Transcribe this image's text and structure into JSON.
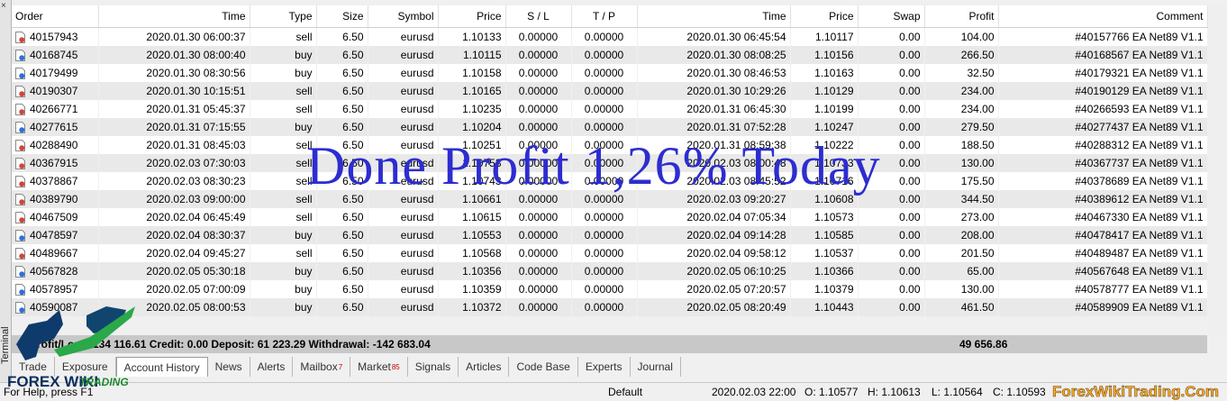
{
  "window": {
    "side_panel_label": "Terminal",
    "close_glyph": "×"
  },
  "columns": [
    "Order",
    "Time",
    "Type",
    "Size",
    "Symbol",
    "Price",
    "S / L",
    "T / P",
    "Time",
    "Price",
    "Swap",
    "Profit",
    "Comment"
  ],
  "rows": [
    {
      "order": "40157943",
      "open_time": "2020.01.30 06:00:37",
      "type": "sell",
      "size": "6.50",
      "symbol": "eurusd",
      "open_price": "1.10133",
      "sl": "0.00000",
      "tp": "0.00000",
      "close_time": "2020.01.30 06:45:54",
      "close_price": "1.10117",
      "swap": "0.00",
      "profit": "104.00",
      "comment": "#40157766 EA Net89 V1.1"
    },
    {
      "order": "40168745",
      "open_time": "2020.01.30 08:00:40",
      "type": "buy",
      "size": "6.50",
      "symbol": "eurusd",
      "open_price": "1.10115",
      "sl": "0.00000",
      "tp": "0.00000",
      "close_time": "2020.01.30 08:08:25",
      "close_price": "1.10156",
      "swap": "0.00",
      "profit": "266.50",
      "comment": "#40168567 EA Net89 V1.1"
    },
    {
      "order": "40179499",
      "open_time": "2020.01.30 08:30:56",
      "type": "buy",
      "size": "6.50",
      "symbol": "eurusd",
      "open_price": "1.10158",
      "sl": "0.00000",
      "tp": "0.00000",
      "close_time": "2020.01.30 08:46:53",
      "close_price": "1.10163",
      "swap": "0.00",
      "profit": "32.50",
      "comment": "#40179321 EA Net89 V1.1"
    },
    {
      "order": "40190307",
      "open_time": "2020.01.30 10:15:51",
      "type": "sell",
      "size": "6.50",
      "symbol": "eurusd",
      "open_price": "1.10165",
      "sl": "0.00000",
      "tp": "0.00000",
      "close_time": "2020.01.30 10:29:26",
      "close_price": "1.10129",
      "swap": "0.00",
      "profit": "234.00",
      "comment": "#40190129 EA Net89 V1.1"
    },
    {
      "order": "40266771",
      "open_time": "2020.01.31 05:45:37",
      "type": "sell",
      "size": "6.50",
      "symbol": "eurusd",
      "open_price": "1.10235",
      "sl": "0.00000",
      "tp": "0.00000",
      "close_time": "2020.01.31 06:45:30",
      "close_price": "1.10199",
      "swap": "0.00",
      "profit": "234.00",
      "comment": "#40266593 EA Net89 V1.1"
    },
    {
      "order": "40277615",
      "open_time": "2020.01.31 07:15:55",
      "type": "buy",
      "size": "6.50",
      "symbol": "eurusd",
      "open_price": "1.10204",
      "sl": "0.00000",
      "tp": "0.00000",
      "close_time": "2020.01.31 07:52:28",
      "close_price": "1.10247",
      "swap": "0.00",
      "profit": "279.50",
      "comment": "#40277437 EA Net89 V1.1"
    },
    {
      "order": "40288490",
      "open_time": "2020.01.31 08:45:03",
      "type": "sell",
      "size": "6.50",
      "symbol": "eurusd",
      "open_price": "1.10251",
      "sl": "0.00000",
      "tp": "0.00000",
      "close_time": "2020.01.31 08:59:38",
      "close_price": "1.10222",
      "swap": "0.00",
      "profit": "188.50",
      "comment": "#40288312 EA Net89 V1.1"
    },
    {
      "order": "40367915",
      "open_time": "2020.02.03 07:30:03",
      "type": "sell",
      "size": "6.50",
      "symbol": "eurusd",
      "open_price": "1.10753",
      "sl": "0.00000",
      "tp": "0.00000",
      "close_time": "2020.02.03 08:00:48",
      "close_price": "1.10733",
      "swap": "0.00",
      "profit": "130.00",
      "comment": "#40367737 EA Net89 V1.1"
    },
    {
      "order": "40378867",
      "open_time": "2020.02.03 08:30:23",
      "type": "sell",
      "size": "6.50",
      "symbol": "eurusd",
      "open_price": "1.10743",
      "sl": "0.00000",
      "tp": "0.00000",
      "close_time": "2020.02.03 08:45:52",
      "close_price": "1.10716",
      "swap": "0.00",
      "profit": "175.50",
      "comment": "#40378689 EA Net89 V1.1"
    },
    {
      "order": "40389790",
      "open_time": "2020.02.03 09:00:00",
      "type": "sell",
      "size": "6.50",
      "symbol": "eurusd",
      "open_price": "1.10661",
      "sl": "0.00000",
      "tp": "0.00000",
      "close_time": "2020.02.03 09:20:27",
      "close_price": "1.10608",
      "swap": "0.00",
      "profit": "344.50",
      "comment": "#40389612 EA Net89 V1.1"
    },
    {
      "order": "40467509",
      "open_time": "2020.02.04 06:45:49",
      "type": "sell",
      "size": "6.50",
      "symbol": "eurusd",
      "open_price": "1.10615",
      "sl": "0.00000",
      "tp": "0.00000",
      "close_time": "2020.02.04 07:05:34",
      "close_price": "1.10573",
      "swap": "0.00",
      "profit": "273.00",
      "comment": "#40467330 EA Net89 V1.1"
    },
    {
      "order": "40478597",
      "open_time": "2020.02.04 08:30:37",
      "type": "buy",
      "size": "6.50",
      "symbol": "eurusd",
      "open_price": "1.10553",
      "sl": "0.00000",
      "tp": "0.00000",
      "close_time": "2020.02.04 09:14:28",
      "close_price": "1.10585",
      "swap": "0.00",
      "profit": "208.00",
      "comment": "#40478417 EA Net89 V1.1"
    },
    {
      "order": "40489667",
      "open_time": "2020.02.04 09:45:27",
      "type": "sell",
      "size": "6.50",
      "symbol": "eurusd",
      "open_price": "1.10568",
      "sl": "0.00000",
      "tp": "0.00000",
      "close_time": "2020.02.04 09:58:12",
      "close_price": "1.10537",
      "swap": "0.00",
      "profit": "201.50",
      "comment": "#40489487 EA Net89 V1.1"
    },
    {
      "order": "40567828",
      "open_time": "2020.02.05 05:30:18",
      "type": "buy",
      "size": "6.50",
      "symbol": "eurusd",
      "open_price": "1.10356",
      "sl": "0.00000",
      "tp": "0.00000",
      "close_time": "2020.02.05 06:10:25",
      "close_price": "1.10366",
      "swap": "0.00",
      "profit": "65.00",
      "comment": "#40567648 EA Net89 V1.1"
    },
    {
      "order": "40578957",
      "open_time": "2020.02.05 07:00:09",
      "type": "buy",
      "size": "6.50",
      "symbol": "eurusd",
      "open_price": "1.10359",
      "sl": "0.00000",
      "tp": "0.00000",
      "close_time": "2020.02.05 07:20:57",
      "close_price": "1.10379",
      "swap": "0.00",
      "profit": "130.00",
      "comment": "#40578777 EA Net89 V1.1"
    },
    {
      "order": "40590087",
      "open_time": "2020.02.05 08:00:53",
      "type": "buy",
      "size": "6.50",
      "symbol": "eurusd",
      "open_price": "1.10372",
      "sl": "0.00000",
      "tp": "0.00000",
      "close_time": "2020.02.05 08:20:49",
      "close_price": "1.10443",
      "swap": "0.00",
      "profit": "461.50",
      "comment": "#40589909 EA Net89 V1.1"
    }
  ],
  "summary": {
    "totals_text": "Profit/Loss: 134 116.61  Credit: 0.00  Deposit: 61 223.29  Withdrawal: -142 683.04",
    "profit_total": "49 656.86"
  },
  "tabs": [
    {
      "label": "Trade",
      "badge": ""
    },
    {
      "label": "Exposure",
      "badge": ""
    },
    {
      "label": "Account History",
      "badge": "",
      "active": true
    },
    {
      "label": "News",
      "badge": ""
    },
    {
      "label": "Alerts",
      "badge": ""
    },
    {
      "label": "Mailbox",
      "badge": "7"
    },
    {
      "label": "Market",
      "badge": "85"
    },
    {
      "label": "Signals",
      "badge": ""
    },
    {
      "label": "Articles",
      "badge": ""
    },
    {
      "label": "Code Base",
      "badge": ""
    },
    {
      "label": "Experts",
      "badge": ""
    },
    {
      "label": "Journal",
      "badge": ""
    }
  ],
  "status": {
    "help": "For Help, press F1",
    "profile": "Default",
    "datetime": "2020.02.03 22:00",
    "open": "O: 1.10577",
    "high": "H: 1.10613",
    "low": "L: 1.10564",
    "close": "C: 1.10593"
  },
  "overlay": {
    "headline": "Done Profit 1,26% Today"
  },
  "branding": {
    "logo_text": "FOREX WIKI",
    "logo_sub": "TRADING",
    "watermark": "ForexWikiTrading.Com"
  },
  "colors": {
    "sell_icon": "#d0463a",
    "buy_icon": "#2f6fd6",
    "overlay": "#2d2dd0",
    "summary_bar": "#c8c8c8"
  }
}
